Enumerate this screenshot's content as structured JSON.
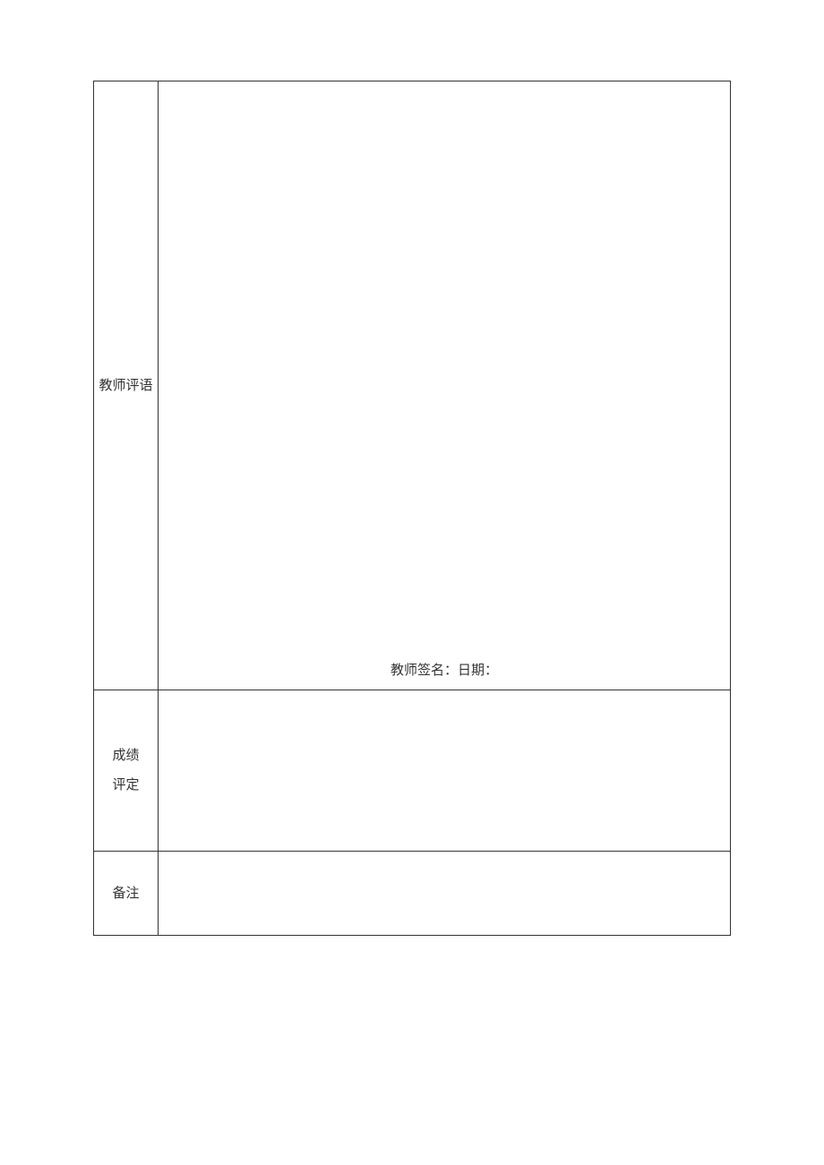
{
  "rows": {
    "teacherComment": {
      "label": "教师评语",
      "signature": "教师签名：日期："
    },
    "gradeAssessment": {
      "labelLine1": "成绩",
      "labelLine2": "评定"
    },
    "remarks": {
      "label": "备注"
    }
  }
}
